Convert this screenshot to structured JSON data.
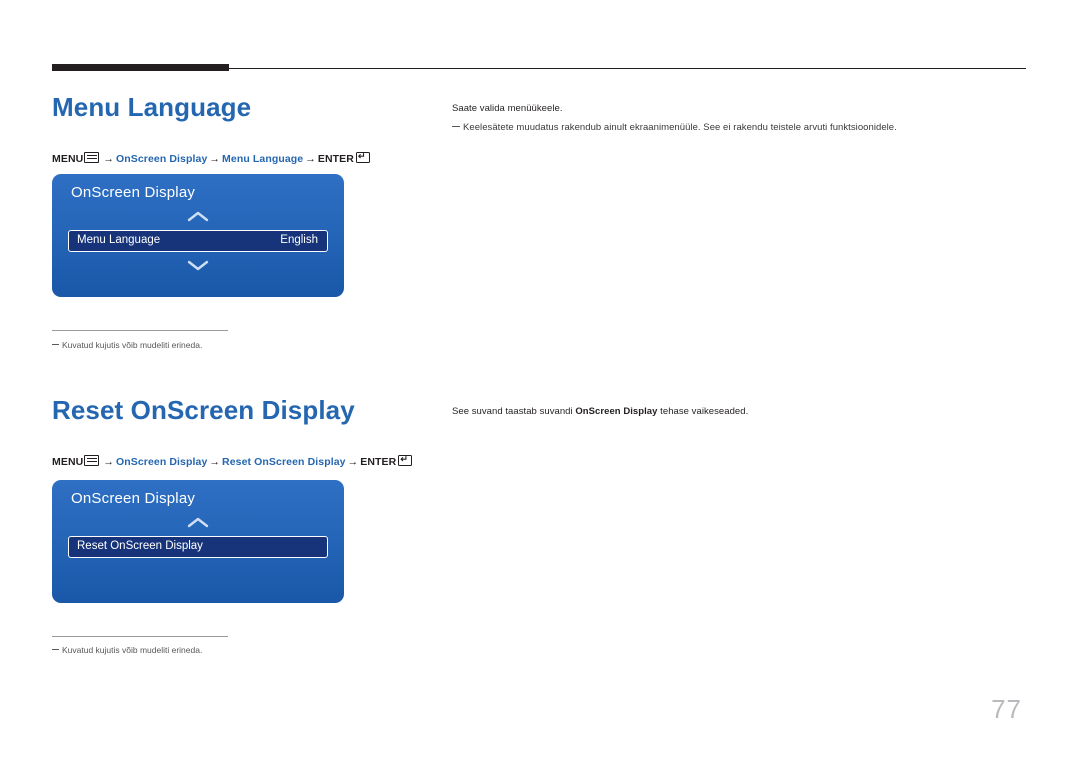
{
  "page": {
    "number": "77"
  },
  "sections": [
    {
      "heading": "Menu Language",
      "breadcrumb": {
        "menu_label": "MENU",
        "step1": "OnScreen Display",
        "step2": "Menu Language",
        "enter_label": "ENTER",
        "arrow": "→"
      },
      "osd": {
        "title": "OnScreen Display",
        "row_label": "Menu Language",
        "row_value": "English",
        "up_chevron": "chevron-up-icon",
        "down_chevron": "chevron-down-icon"
      },
      "note": "Kuvatud kujutis võib mudeliti erineda.",
      "description": "Saate valida menüükeele.",
      "sub_description": "Keelesätete muudatus rakendub ainult ekraanimenüüle. See ei rakendu teistele arvuti funktsioonidele."
    },
    {
      "heading": "Reset OnScreen Display",
      "breadcrumb": {
        "menu_label": "MENU",
        "step1": "OnScreen Display",
        "step2": "Reset OnScreen Display",
        "enter_label": "ENTER",
        "arrow": "→"
      },
      "osd": {
        "title": "OnScreen Display",
        "row_label": "Reset OnScreen Display",
        "row_value": "",
        "up_chevron": "chevron-up-icon",
        "down_chevron": ""
      },
      "note": "Kuvatud kujutis võib mudeliti erineda.",
      "description_pre": "See suvand taastab suvandi ",
      "description_bold": "OnScreen Display",
      "description_post": " tehase vaikeseaded."
    }
  ],
  "colors": {
    "accent": "#2566b0",
    "osd_panel": "#2566b8",
    "osd_row": "#17347a",
    "page_number": "#b8babd"
  }
}
